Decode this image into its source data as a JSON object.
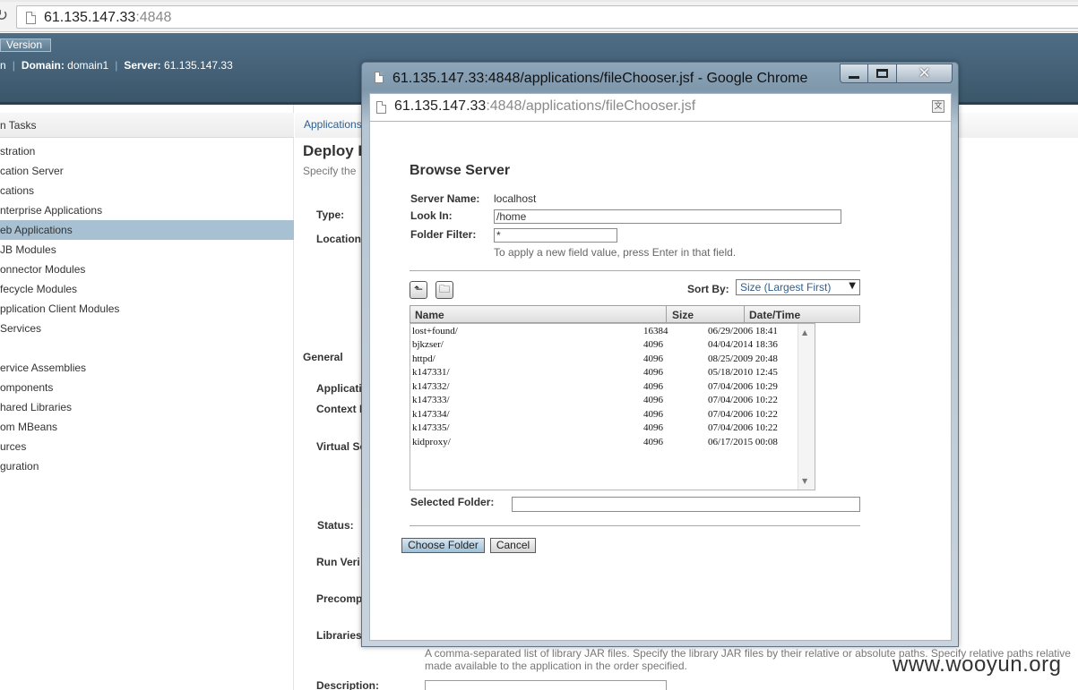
{
  "browser": {
    "url_host": "61.135.147.33",
    "url_port": ":4848"
  },
  "header": {
    "version_button": "Version",
    "user_fragment": "n",
    "domain_label": "Domain:",
    "domain_value": "domain1",
    "server_label": "Server:",
    "server_value": "61.135.147.33"
  },
  "nav": {
    "heading": "n Tasks",
    "items": [
      {
        "label": "stration"
      },
      {
        "label": "cation Server"
      },
      {
        "label": "cations"
      },
      {
        "label": "nterprise Applications"
      },
      {
        "label": "eb Applications"
      },
      {
        "label": "JB Modules"
      },
      {
        "label": "onnector Modules"
      },
      {
        "label": "fecycle Modules"
      },
      {
        "label": "pplication Client Modules"
      },
      {
        "label": "Services"
      },
      {
        "label": "ervice Assemblies"
      },
      {
        "label": "omponents"
      },
      {
        "label": "hared Libraries"
      },
      {
        "label": "om MBeans"
      },
      {
        "label": "urces"
      },
      {
        "label": "guration"
      }
    ]
  },
  "content": {
    "breadcrumb": "Applications",
    "page_title": "Deploy E",
    "page_help": "Specify the",
    "type_label": "Type:",
    "location_label": "Location",
    "general_section": "General",
    "applic_label": "Applicati",
    "context_label": "Context I",
    "virtual_label": "Virtual Se",
    "status_label": "Status:",
    "run_verifier_label": "Run Veri",
    "precompile_label": "Precomp",
    "libraries_label": "Libraries",
    "libraries_help": "A comma-separated list of library JAR files. Specify the library JAR files by their relative or absolute paths. Specify relative paths relative",
    "libraries_help2": "made available to the application in the order specified.",
    "description_label": "Description:"
  },
  "popup": {
    "window_title": "61.135.147.33:4848/applications/fileChooser.jsf - Google Chrome",
    "url_host": "61.135.147.33",
    "url_path": ":4848/applications/fileChooser.jsf",
    "heading": "Browse Server",
    "server_name_label": "Server Name:",
    "server_name_value": "localhost",
    "look_in_label": "Look In:",
    "look_in_value": "/home",
    "folder_filter_label": "Folder Filter:",
    "folder_filter_value": "*",
    "hint": "To apply a new field value, press Enter in that field.",
    "sort_by_label": "Sort By:",
    "sort_by_value": "Size (Largest First)",
    "columns": {
      "name": "Name",
      "size": "Size",
      "date": "Date/Time"
    },
    "files": [
      {
        "name": "lost+found/",
        "size": "16384",
        "date": "06/29/2006 18:41"
      },
      {
        "name": "bjkzser/",
        "size": "4096",
        "date": "04/04/2014 18:36"
      },
      {
        "name": "httpd/",
        "size": "4096",
        "date": "08/25/2009 20:48"
      },
      {
        "name": "k147331/",
        "size": "4096",
        "date": "05/18/2010 12:45"
      },
      {
        "name": "k147332/",
        "size": "4096",
        "date": "07/04/2006 10:29"
      },
      {
        "name": "k147333/",
        "size": "4096",
        "date": "07/04/2006 10:22"
      },
      {
        "name": "k147334/",
        "size": "4096",
        "date": "07/04/2006 10:22"
      },
      {
        "name": "k147335/",
        "size": "4096",
        "date": "07/04/2006 10:22"
      },
      {
        "name": "kidproxy/",
        "size": "4096",
        "date": "06/17/2015 00:08"
      }
    ],
    "selected_folder_label": "Selected Folder:",
    "selected_folder_value": "",
    "choose_button": "Choose Folder",
    "cancel_button": "Cancel"
  },
  "watermark": "www.wooyun.org"
}
